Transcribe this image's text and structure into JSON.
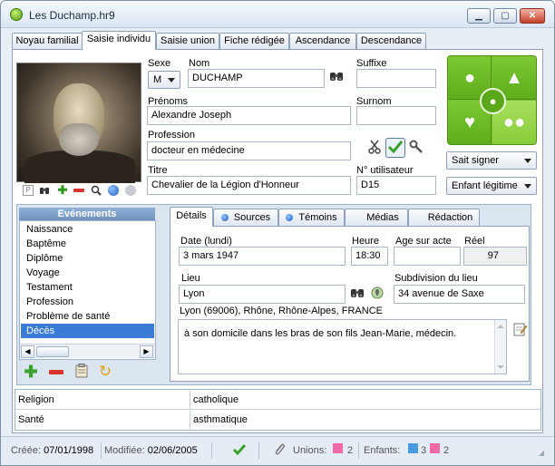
{
  "window": {
    "title": "Les Duchamp.hr9",
    "controls": {
      "minimize": "▁",
      "maximize": "▢",
      "close": "✕"
    }
  },
  "tabs": [
    {
      "label": "Noyau familial"
    },
    {
      "label": "Saisie individu"
    },
    {
      "label": "Saisie union"
    },
    {
      "label": "Fiche rédigée"
    },
    {
      "label": "Ascendance"
    },
    {
      "label": "Descendance"
    }
  ],
  "active_tab": "Saisie individu",
  "person": {
    "sexe_label": "Sexe",
    "sexe_value": "M",
    "nom_label": "Nom",
    "nom_value": "DUCHAMP",
    "suffixe_label": "Suffixe",
    "suffixe_value": "",
    "prenoms_label": "Prénoms",
    "prenoms_value": "Alexandre Joseph",
    "surnom_label": "Surnom",
    "surnom_value": "",
    "profession_label": "Profession",
    "profession_value": "docteur en médecine",
    "titre_label": "Titre",
    "titre_value": "Chevalier de la Légion d'Honneur",
    "n_utilisateur_label": "N° utilisateur",
    "n_utilisateur_value": "D15",
    "signature_select": "Sait signer",
    "filiation_select": "Enfant légitime"
  },
  "photo_tools": {
    "p_icon": "P"
  },
  "events": {
    "title": "Evénements",
    "items": [
      {
        "label": "Naissance"
      },
      {
        "label": "Baptême"
      },
      {
        "label": "Diplôme"
      },
      {
        "label": "Voyage"
      },
      {
        "label": "Testament"
      },
      {
        "label": "Profession"
      },
      {
        "label": "Problème de santé"
      },
      {
        "label": "Décès"
      }
    ],
    "selected": "Décès"
  },
  "detail_tabs": [
    {
      "label": "Détails"
    },
    {
      "label": "Sources"
    },
    {
      "label": "Témoins"
    },
    {
      "label": "Médias"
    },
    {
      "label": "Rédaction"
    }
  ],
  "event_detail": {
    "date_label": "Date (lundi)",
    "date_value": "3 mars 1947",
    "heure_label": "Heure",
    "heure_value": "18:30",
    "age_label": "Age sur acte",
    "age_value": "",
    "reel_label": "Réel",
    "reel_value": "97",
    "lieu_label": "Lieu",
    "lieu_value": "Lyon",
    "subdivision_label": "Subdivision du lieu",
    "subdivision_value": "34 avenue de Saxe",
    "lieu_full": "Lyon (69006), Rhône, Rhône-Alpes, FRANCE",
    "note": "à son domicile dans les bras de son fils Jean-Marie, médecin."
  },
  "attributes": [
    {
      "key": "Religion",
      "value": "catholique"
    },
    {
      "key": "Santé",
      "value": "asthmatique"
    }
  ],
  "status": {
    "creee_label": "Créée:",
    "creee_value": "07/01/1998",
    "modifiee_label": "Modifiée:",
    "modifiee_value": "02/06/2005",
    "unions_label": "Unions:",
    "unions_value": "2",
    "enfants_label": "Enfants:",
    "enfants_boys": "3",
    "enfants_girls": "2"
  },
  "colors": {
    "accent_green": "#74c22a",
    "selection_blue": "#3a7bd5",
    "female_pink": "#f06aa8",
    "male_blue": "#4a9ae0"
  }
}
